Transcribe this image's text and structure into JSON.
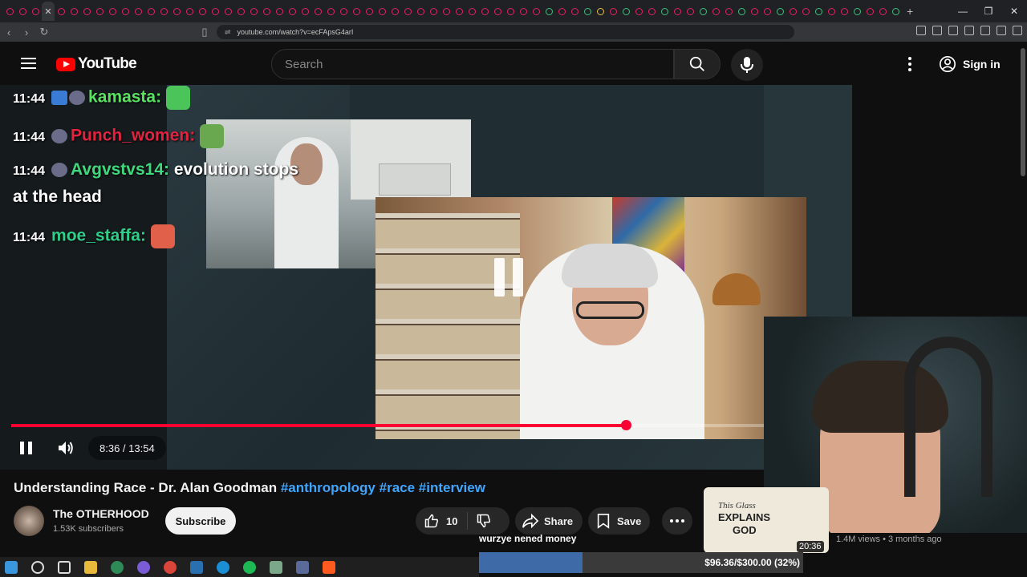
{
  "browser": {
    "url": "youtube.com/watch?v=ecFApsG4arI",
    "active_tab_close": "✕",
    "new_tab": "+"
  },
  "header": {
    "logo_text": "YouTube",
    "search_placeholder": "Search",
    "signin_label": "Sign in"
  },
  "chat": [
    {
      "time": "11:44",
      "user": "kamasta",
      "color": "#58e35f",
      "message": ""
    },
    {
      "time": "11:44",
      "user": "Punch_women",
      "color": "#e3233f",
      "message": ""
    },
    {
      "time": "11:44",
      "user": "Avgvstvs14",
      "color": "#3fd97d",
      "message": "evolution stops",
      "message_cont": "at the head"
    },
    {
      "time": "11:44",
      "user": "moe_staffa",
      "color": "#2ecf8a",
      "message": ""
    }
  ],
  "player": {
    "current_time": "8:36",
    "duration": "13:54",
    "time_display": "8:36 / 13:54",
    "progress_fraction": 0.817
  },
  "video": {
    "title": "Understanding Race - Dr. Alan Goodman",
    "tags": [
      "#anthropology",
      "#race",
      "#interview"
    ],
    "channel_name": "The OTHERHOOD",
    "subscribers": "1.53K subscribers",
    "subscribe_label": "Subscribe",
    "likes": "10",
    "share_label": "Share",
    "save_label": "Save"
  },
  "overlay": {
    "donor_text": "wurzye nened money",
    "goal_text": "$96.36/$300.00 (32%)",
    "goal_fraction": 0.32
  },
  "recommended": {
    "thumb_line1": "This Glass",
    "thumb_line2": "EXPLAINS",
    "thumb_line3": "GOD",
    "duration": "20:36",
    "meta": "1.4M views • 3 months ago"
  },
  "colors": {
    "accent_red": "#ff0033",
    "link_blue": "#3ea6ff",
    "background": "#0f0f0f"
  }
}
